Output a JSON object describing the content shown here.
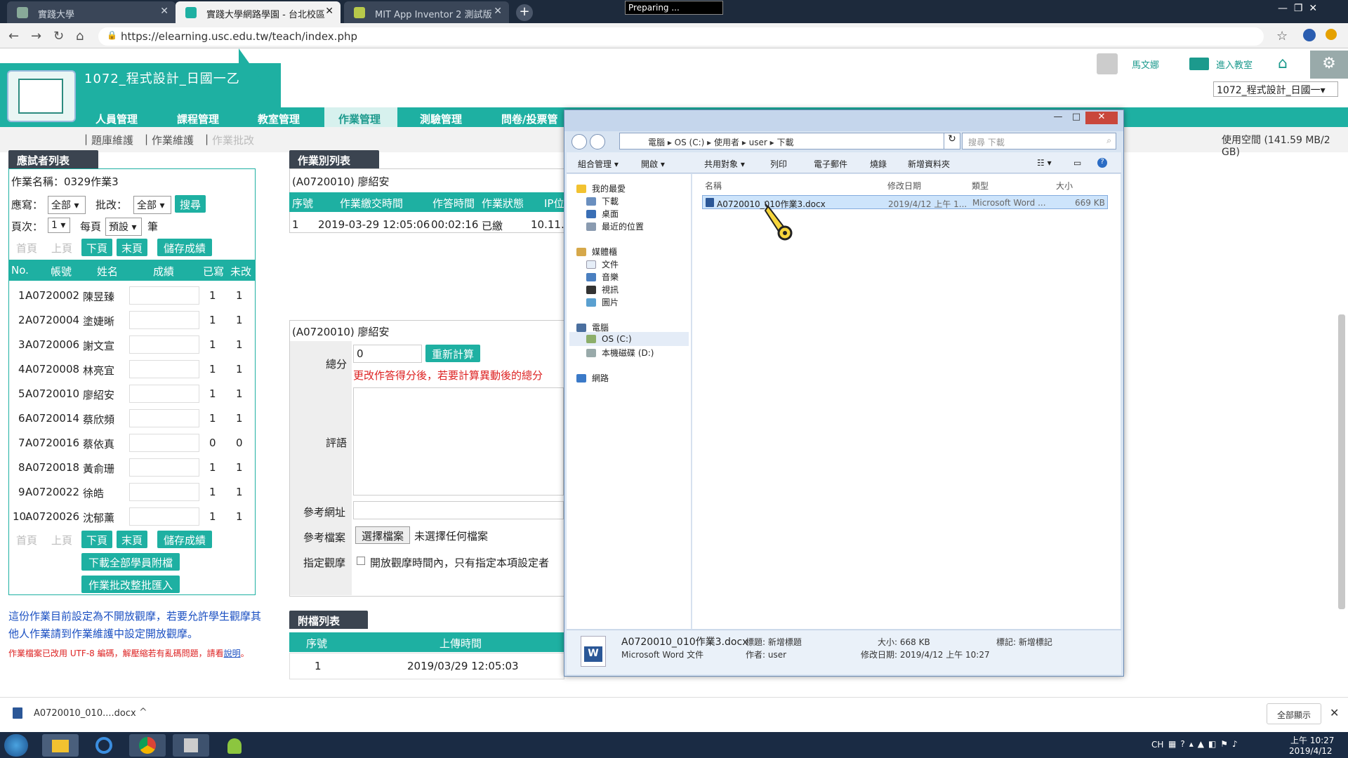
{
  "browser": {
    "tabs": [
      {
        "label": "實踐大學",
        "active": false
      },
      {
        "label": "實踐大學網路學園 - 台北校區",
        "active": true
      },
      {
        "label": "MIT App Inventor 2 測試版",
        "active": false
      }
    ],
    "recorder_status": "Preparing ...",
    "url": "https://elearning.usc.edu.tw/teach/index.php"
  },
  "site": {
    "course_title": "1072_程式設計_日國一乙",
    "user_name": "馬文娜",
    "enter_classroom": "進入教室",
    "course_select": "1072_程式設計_日國一▾",
    "storage": "使用空間 (141.59 MB/2 GB)",
    "nav": [
      "人員管理",
      "課程管理",
      "教室管理",
      "作業管理",
      "測驗管理",
      "問卷/投票管"
    ],
    "subnav": [
      "題庫維護",
      "作業維護",
      "作業批改"
    ]
  },
  "examinees": {
    "panel_title": "應試者列表",
    "hw_name": "作業名稱：0329作業3",
    "filter_submit_label": "應寫：",
    "filter_submit_value": "全部",
    "filter_graded_label": "批改：",
    "filter_graded_value": "全部",
    "search_btn": "搜尋",
    "page_label": "頁次：",
    "page_value": "1",
    "per_page_label": "每頁",
    "per_page_value": "預設",
    "per_page_unit": "筆",
    "pager": {
      "first": "首頁",
      "prev": "上頁",
      "next": "下頁",
      "last": "末頁",
      "save": "儲存成績"
    },
    "columns": [
      "No.",
      "帳號",
      "姓名",
      "成績",
      "已寫",
      "未改"
    ],
    "rows": [
      {
        "no": "1.",
        "account": "A0720002",
        "name": "陳昱臻",
        "written": "1",
        "ungraded": "1"
      },
      {
        "no": "2.",
        "account": "A0720004",
        "name": "塗婕晰",
        "written": "1",
        "ungraded": "1"
      },
      {
        "no": "3.",
        "account": "A0720006",
        "name": "謝文宣",
        "written": "1",
        "ungraded": "1"
      },
      {
        "no": "4.",
        "account": "A0720008",
        "name": "林亮宜",
        "written": "1",
        "ungraded": "1"
      },
      {
        "no": "5.",
        "account": "A0720010",
        "name": "廖紹安",
        "written": "1",
        "ungraded": "1"
      },
      {
        "no": "6.",
        "account": "A0720014",
        "name": "蔡欣頻",
        "written": "1",
        "ungraded": "1"
      },
      {
        "no": "7.",
        "account": "A0720016",
        "name": "蔡依真",
        "written": "0",
        "ungraded": "0"
      },
      {
        "no": "8.",
        "account": "A0720018",
        "name": "黃俞珊",
        "written": "1",
        "ungraded": "1"
      },
      {
        "no": "9.",
        "account": "A0720022",
        "name": "徐皓",
        "written": "1",
        "ungraded": "1"
      },
      {
        "no": "10.",
        "account": "A0720026",
        "name": "沈郁薰",
        "written": "1",
        "ungraded": "1"
      }
    ],
    "download_all_btn": "下載全部學員附檔",
    "import_btn": "作業批改整批匯入",
    "notice1": "這份作業目前設定為不開放觀摩，若要允許學生觀摩其他人作業請到作業維護中設定開放觀摩。",
    "notice2": "作業檔案已改用 UTF-8 編碼，解壓縮若有亂碼問題，請看",
    "notice2_link": "說明",
    "notice2_end": "。"
  },
  "hw_list": {
    "panel_title": "作業別列表",
    "student": "(A0720010) 廖紹安",
    "columns": [
      "序號",
      "作業繳交時間",
      "作答時間",
      "作業狀態",
      "IP位"
    ],
    "row": {
      "no": "1",
      "time": "2019-03-29 12:05:06",
      "duration": "00:02:16",
      "status": "已繳",
      "ip": "10.11."
    }
  },
  "grading": {
    "student": "(A0720010) 廖紹安",
    "total_label": "總分",
    "total_value": "0",
    "recalc_btn": "重新計算",
    "warning": "更改作答得分後，若要計算異動後的總分",
    "comment_label": "評語",
    "ref_url_label": "參考網址",
    "ref_file_label": "參考檔案",
    "choose_file_btn": "選擇檔案",
    "no_file": "未選擇任何檔案",
    "view_label": "指定觀摩",
    "view_text": "開放觀摩時間內，只有指定本項設定者"
  },
  "attachments": {
    "panel_title": "附檔列表",
    "columns": [
      "序號",
      "上傳時間"
    ],
    "row": {
      "no": "1",
      "time": "2019/03/29 12:05:03"
    }
  },
  "explorer": {
    "path": [
      "電腦",
      "OS (C:)",
      "使用者",
      "user",
      "下載"
    ],
    "search_placeholder": "搜尋 下載",
    "toolbar": [
      "組合管理 ▾",
      "開啟 ▾",
      "共用對象 ▾",
      "列印",
      "電子郵件",
      "燒錄",
      "新增資料夾"
    ],
    "nav": {
      "favorites": "我的最愛",
      "downloads": "下載",
      "desktop": "桌面",
      "recent": "最近的位置",
      "libraries": "媒體櫃",
      "documents": "文件",
      "music": "音樂",
      "videos": "視訊",
      "pictures": "圖片",
      "computer": "電腦",
      "drive_c": "OS (C:)",
      "drive_d": "本機磁碟 (D:)",
      "network": "網路"
    },
    "columns": [
      "名稱",
      "修改日期",
      "類型",
      "大小"
    ],
    "file": {
      "name": "A0720010_010作業3.docx",
      "date": "2019/4/12 上午 1...",
      "type": "Microsoft Word ...",
      "size": "669 KB"
    },
    "details": {
      "name": "A0720010_010作業3.docx",
      "kind": "Microsoft Word 文件",
      "title_label": "標題: 新增標題",
      "author_label": "作者: user",
      "size_label": "大小: 668 KB",
      "modified_label": "修改日期: 2019/4/12 上午 10:27",
      "tags_label": "標記: 新增標記"
    }
  },
  "download_bar": {
    "file": "A0720010_010....docx",
    "show_all": "全部顯示"
  },
  "taskbar": {
    "lang": "CH",
    "time": "上午 10:27",
    "date": "2019/4/12"
  }
}
